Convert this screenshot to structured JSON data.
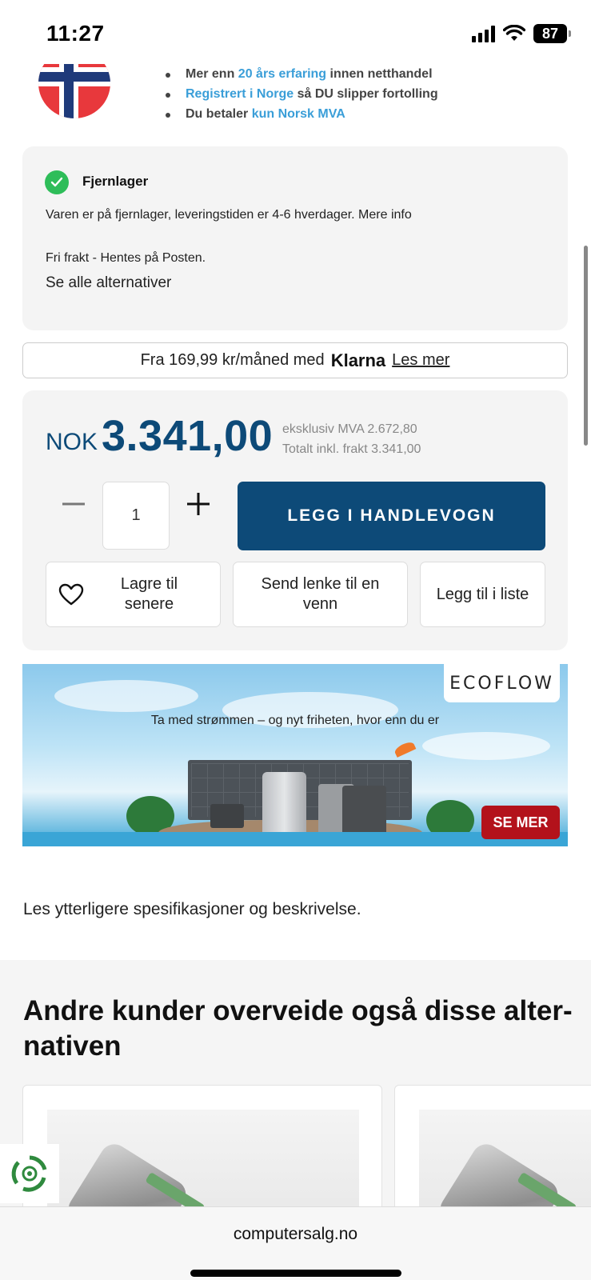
{
  "status_bar": {
    "time": "11:27",
    "battery": "87",
    "icons": [
      "signal-icon",
      "wifi-icon",
      "battery-icon"
    ]
  },
  "usp": {
    "items": [
      {
        "pre": "Mer enn ",
        "highlight": "20 års erfaring",
        "post": " innen netthandel"
      },
      {
        "pre": "",
        "highlight": "Registrert i Norge",
        "post": " så DU slipper fortolling"
      },
      {
        "pre": "Du betaler ",
        "highlight": "kun Norsk MVA",
        "post": ""
      }
    ]
  },
  "stock": {
    "title": "Fjernlager",
    "description": "Varen er på fjernlager, leveringstiden er 4-6 hverdager. Mere info",
    "shipping": "Fri frakt - Hentes på Posten.",
    "alternatives_link": "Se alle alternativer"
  },
  "klarna": {
    "text": "Fra 169,99 kr/måned med",
    "logo": "Klarna",
    "link": "Les mer"
  },
  "price": {
    "currency": "NOK",
    "amount": "3.341,00",
    "ex_vat": "eksklusiv MVA 2.672,80",
    "total": "Totalt inkl. frakt 3.341,00"
  },
  "cart": {
    "quantity": "1",
    "add_label": "LEGG I HANDLEVOGN",
    "save_label": "Lagre til senere",
    "send_label": "Send lenke til en venn",
    "list_label": "Legg til i liste"
  },
  "banner": {
    "brand": "ECOFLOW",
    "tagline": "Ta med strømmen – og nyt friheten, hvor enn du er",
    "cta": "SE MER"
  },
  "spec_link": "Les ytterligere spesifikasjoner og beskrivelse.",
  "recommendations": {
    "title": "Andre kunder overveide også disse alter-nativen"
  },
  "browser": {
    "url": "computersalg.no"
  },
  "colors": {
    "primary": "#0d4a78",
    "link": "#3a9ed8",
    "success": "#2ebd59",
    "cta_red": "#b3121b"
  }
}
